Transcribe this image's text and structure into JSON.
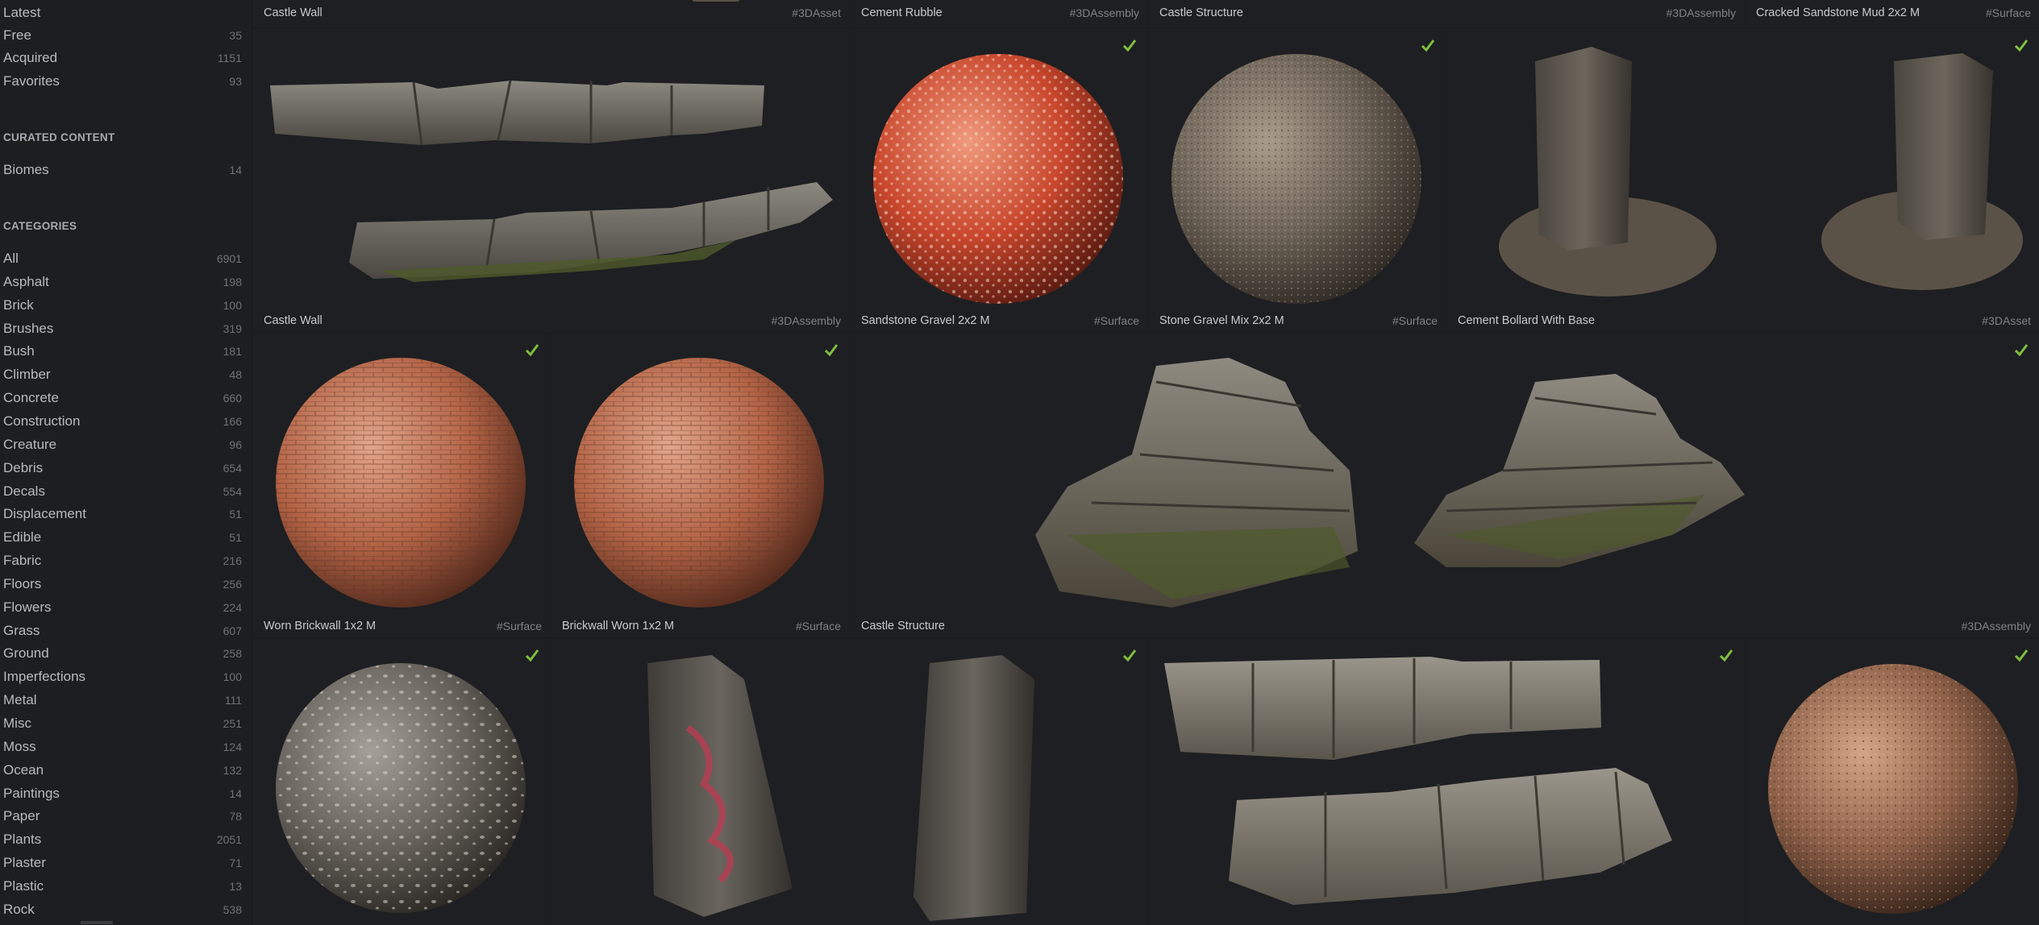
{
  "sidebar": {
    "top_items": [
      {
        "label": "Latest",
        "count": ""
      },
      {
        "label": "Free",
        "count": "35"
      },
      {
        "label": "Acquired",
        "count": "1151"
      },
      {
        "label": "Favorites",
        "count": "93"
      }
    ],
    "curated_heading": "CURATED CONTENT",
    "curated_items": [
      {
        "label": "Biomes",
        "count": "14"
      }
    ],
    "categories_heading": "CATEGORIES",
    "categories": [
      {
        "label": "All",
        "count": "6901"
      },
      {
        "label": "Asphalt",
        "count": "198"
      },
      {
        "label": "Brick",
        "count": "100"
      },
      {
        "label": "Brushes",
        "count": "319"
      },
      {
        "label": "Bush",
        "count": "181"
      },
      {
        "label": "Climber",
        "count": "48"
      },
      {
        "label": "Concrete",
        "count": "660"
      },
      {
        "label": "Construction",
        "count": "166"
      },
      {
        "label": "Creature",
        "count": "96"
      },
      {
        "label": "Debris",
        "count": "654"
      },
      {
        "label": "Decals",
        "count": "554"
      },
      {
        "label": "Displacement",
        "count": "51"
      },
      {
        "label": "Edible",
        "count": "51"
      },
      {
        "label": "Fabric",
        "count": "216"
      },
      {
        "label": "Floors",
        "count": "256"
      },
      {
        "label": "Flowers",
        "count": "224"
      },
      {
        "label": "Grass",
        "count": "607"
      },
      {
        "label": "Ground",
        "count": "258"
      },
      {
        "label": "Imperfections",
        "count": "100"
      },
      {
        "label": "Metal",
        "count": "111"
      },
      {
        "label": "Misc",
        "count": "251"
      },
      {
        "label": "Moss",
        "count": "124"
      },
      {
        "label": "Ocean",
        "count": "132"
      },
      {
        "label": "Paintings",
        "count": "14"
      },
      {
        "label": "Paper",
        "count": "78"
      },
      {
        "label": "Plants",
        "count": "2051"
      },
      {
        "label": "Plaster",
        "count": "71"
      },
      {
        "label": "Plastic",
        "count": "13"
      },
      {
        "label": "Rock",
        "count": "538"
      }
    ]
  },
  "top_strip": [
    {
      "label": "Castle Wall",
      "tag": "#3DAsset"
    },
    {
      "label": "Cement Rubble",
      "tag": "#3DAssembly"
    },
    {
      "label": "Castle Structure",
      "tag": "#3DAssembly"
    },
    {
      "label": "Cracked Sandstone Mud 2x2 M",
      "tag": "#Surface"
    }
  ],
  "row1": [
    {
      "label": "Castle Wall",
      "tag": "#3DAssembly",
      "acquired": false
    },
    {
      "label": "Sandstone Gravel 2x2 M",
      "tag": "#Surface",
      "acquired": true
    },
    {
      "label": "Stone Gravel Mix 2x2 M",
      "tag": "#Surface",
      "acquired": true
    },
    {
      "label": "Cement Bollard With Base",
      "tag": "#3DAsset",
      "acquired": true
    }
  ],
  "row2": [
    {
      "label": "Worn Brickwall 1x2 M",
      "tag": "#Surface",
      "acquired": true
    },
    {
      "label": "Brickwall Worn 1x2 M",
      "tag": "#Surface",
      "acquired": true
    },
    {
      "label": "Castle Structure",
      "tag": "#3DAssembly",
      "acquired": true
    }
  ],
  "row3": [
    {
      "acquired": true
    },
    {
      "acquired": true
    },
    {
      "acquired": true
    },
    {
      "acquired": true
    }
  ],
  "colors": {
    "accent_check": "#7fbf3f",
    "background": "#1b1c1e",
    "tile": "#1e1f22"
  }
}
